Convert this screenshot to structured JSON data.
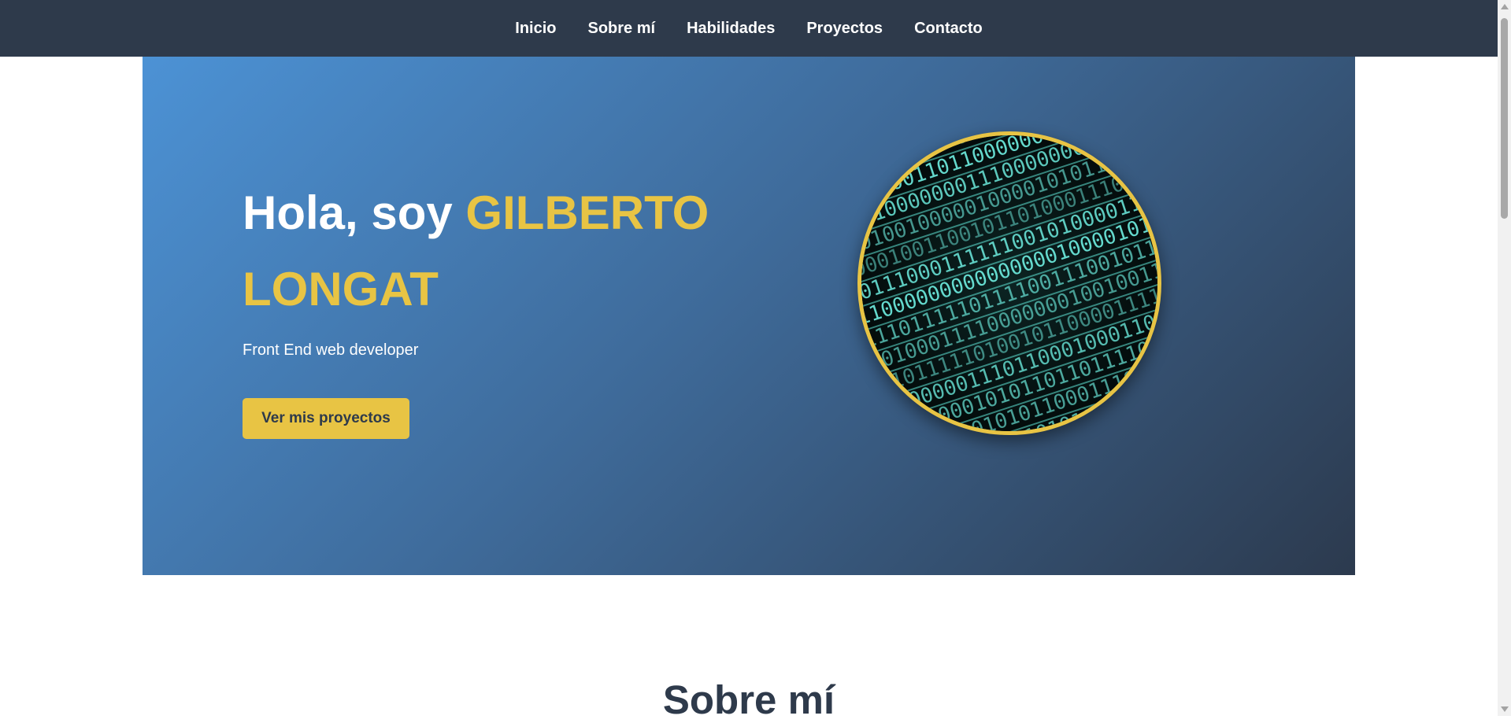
{
  "nav": {
    "items": [
      {
        "label": "Inicio"
      },
      {
        "label": "Sobre mí"
      },
      {
        "label": "Habilidades"
      },
      {
        "label": "Proyectos"
      },
      {
        "label": "Contacto"
      }
    ]
  },
  "hero": {
    "greeting": "Hola, soy ",
    "name": "GILBERTO LONGAT",
    "subtitle": "Front End web developer",
    "button_label": "Ver mis proyectos",
    "image_icon": "binary-code-image"
  },
  "about": {
    "title": "Sobre mí"
  },
  "colors": {
    "nav_background": "#2e3a4b",
    "accent": "#e8c444",
    "gradient_start": "#4c92d5",
    "gradient_end": "#2c3a4e",
    "heading_dark": "#2e3a4b"
  }
}
